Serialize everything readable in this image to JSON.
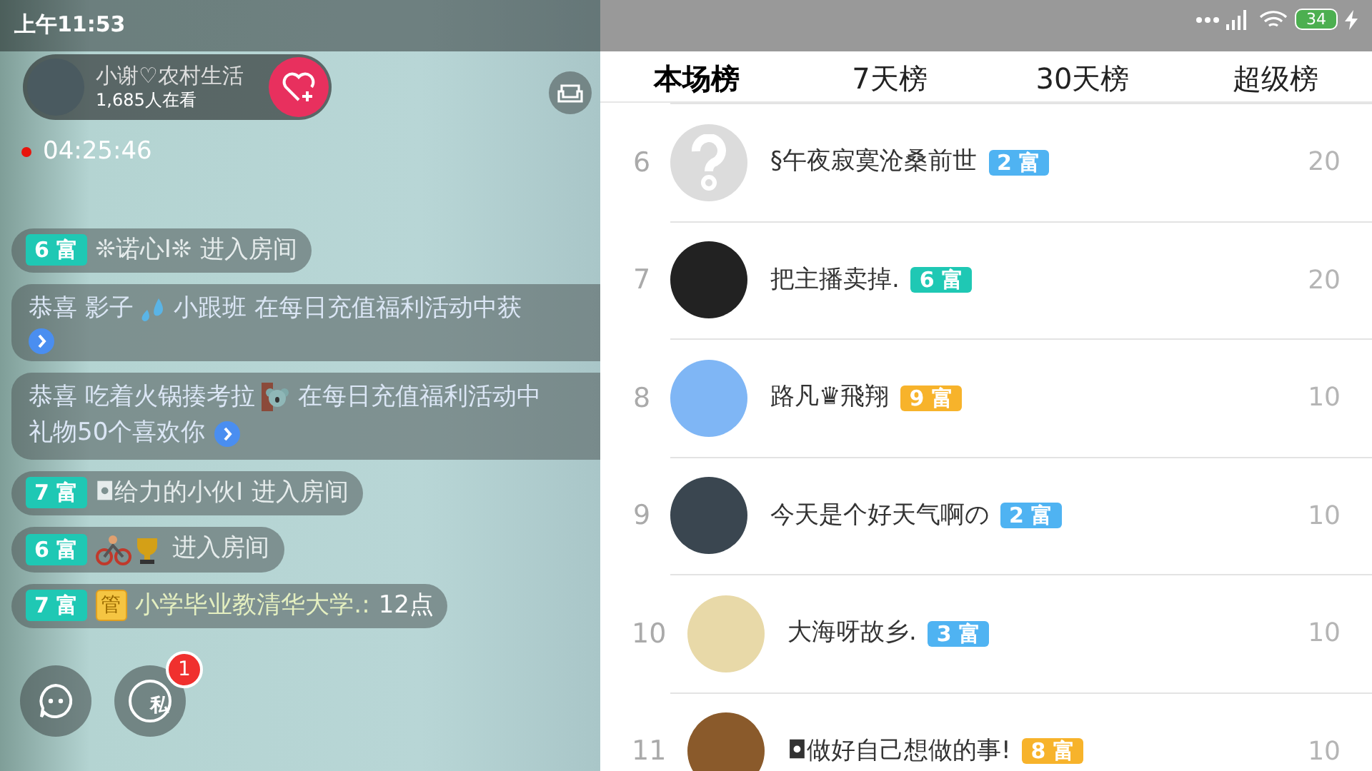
{
  "status_bar": {
    "time": "上午11:53",
    "battery": "34"
  },
  "streamer": {
    "name": "小谢♡农村生活",
    "viewers": "1,685人在看"
  },
  "live_timer": "04:25:46",
  "chat": [
    {
      "kind": "enter",
      "badge": {
        "text": "6 富",
        "color": "#1fc8b4"
      },
      "name": "❊诺心I❊",
      "action": "进入房间"
    },
    {
      "kind": "gift",
      "text_start": "恭喜 影子",
      "text_end": "小跟班  在每日充值福利活动中获"
    },
    {
      "kind": "gift",
      "text_start": "恭喜 吃着火锅揍考拉",
      "text_end": "在每日充值福利活动中",
      "text_line2": "礼物50个喜欢你"
    },
    {
      "kind": "enter",
      "badge": {
        "text": "7 富",
        "color": "#1fc8b4"
      },
      "name": "◘给力的小伙I",
      "action": "进入房间"
    },
    {
      "kind": "enter",
      "badge": {
        "text": "6 富",
        "color": "#1fc8b4"
      },
      "action": "进入房间"
    },
    {
      "kind": "chat",
      "badge": {
        "text": "7 富",
        "color": "#1fc8b4"
      },
      "role": "管",
      "name": "小学毕业教清华大学.:",
      "message": "12点"
    }
  ],
  "private_messages": {
    "label": "私",
    "unread": "1"
  },
  "tabs": [
    {
      "label": "本场榜",
      "selected": true
    },
    {
      "label": "7天榜",
      "selected": false
    },
    {
      "label": "30天榜",
      "selected": false
    },
    {
      "label": "超级榜",
      "selected": false
    }
  ],
  "ranking": [
    {
      "rank": "6",
      "kind": "unknown",
      "name": "§午夜寂寞沧桑前世",
      "badge": {
        "text": "2 富",
        "color": "#4fb3f2"
      },
      "score": "20"
    },
    {
      "rank": "7",
      "kind": "photo",
      "name": "把主播卖掉.",
      "badge": {
        "text": "6 富",
        "color": "#1fc8b4"
      },
      "score": "20"
    },
    {
      "rank": "8",
      "kind": "photo",
      "name": "路凡♛飛翔",
      "badge": {
        "text": "9 富",
        "color": "#f7b32b"
      },
      "score": "10"
    },
    {
      "rank": "9",
      "kind": "photo",
      "name": "今天是个好天气啊の",
      "badge": {
        "text": "2 富",
        "color": "#4fb3f2"
      },
      "score": "10"
    },
    {
      "rank": "10",
      "kind": "photo",
      "name": "大海呀故乡.",
      "badge": {
        "text": "3 富",
        "color": "#4fb3f2"
      },
      "score": "10"
    },
    {
      "rank": "11",
      "kind": "photo",
      "name": "◘做好自己想做的事!",
      "badge": {
        "text": "8 富",
        "color": "#f7b32b"
      },
      "score": "10"
    }
  ]
}
